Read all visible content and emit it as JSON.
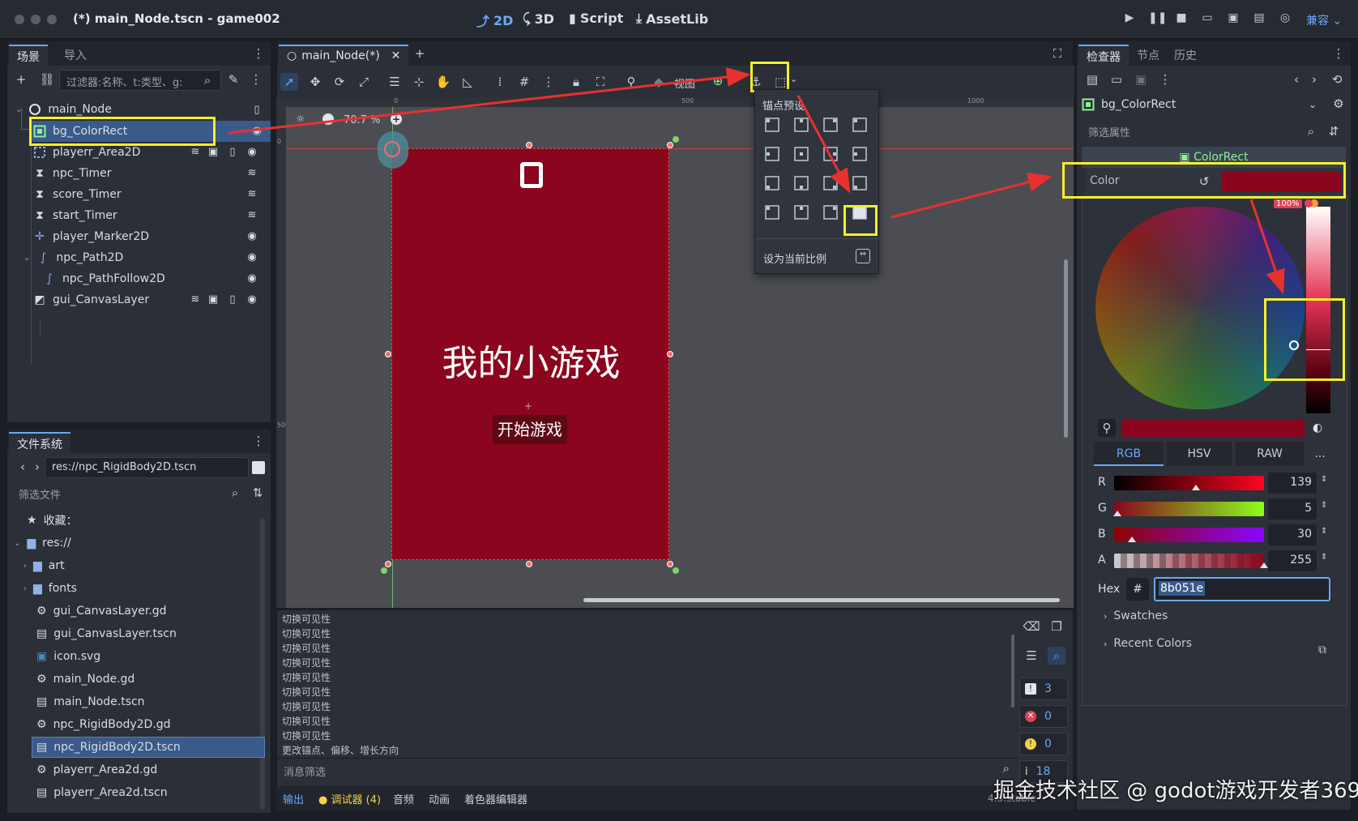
{
  "window": {
    "title": "(*) main_Node.tscn - game002"
  },
  "workspaces": [
    {
      "label": "2D",
      "icon": "2d-icon"
    },
    {
      "label": "3D",
      "icon": "3d-icon"
    },
    {
      "label": "Script",
      "icon": "script-icon"
    },
    {
      "label": "AssetLib",
      "icon": "assetlib-icon"
    }
  ],
  "renderer": "兼容",
  "scene_dock": {
    "tabs": [
      "场景",
      "导入"
    ],
    "filter_placeholder": "过滤器:名称、t:类型、g:",
    "nodes": [
      {
        "name": "main_Node",
        "icon": "node-icon"
      },
      {
        "name": "bg_ColorRect",
        "icon": "colorrect-icon"
      },
      {
        "name": "playerr_Area2D",
        "icon": "area2d-icon"
      },
      {
        "name": "npc_Timer",
        "icon": "timer-icon"
      },
      {
        "name": "score_Timer",
        "icon": "timer-icon"
      },
      {
        "name": "start_Timer",
        "icon": "timer-icon"
      },
      {
        "name": "player_Marker2D",
        "icon": "marker2d-icon"
      },
      {
        "name": "npc_Path2D",
        "icon": "path2d-icon"
      },
      {
        "name": "npc_PathFollow2D",
        "icon": "pathfollow2d-icon"
      },
      {
        "name": "gui_CanvasLayer",
        "icon": "canvaslayer-icon"
      }
    ]
  },
  "filesystem_dock": {
    "tab": "文件系统",
    "path": "res://npc_RigidBody2D.tscn",
    "filter_placeholder": "筛选文件",
    "favorites_label": "收藏：",
    "root": "res://",
    "items": [
      {
        "name": "art",
        "type": "folder"
      },
      {
        "name": "fonts",
        "type": "folder"
      },
      {
        "name": "gui_CanvasLayer.gd",
        "type": "script"
      },
      {
        "name": "gui_CanvasLayer.tscn",
        "type": "scene"
      },
      {
        "name": "icon.svg",
        "type": "image"
      },
      {
        "name": "main_Node.gd",
        "type": "script"
      },
      {
        "name": "main_Node.tscn",
        "type": "scene"
      },
      {
        "name": "npc_RigidBody2D.gd",
        "type": "script"
      },
      {
        "name": "npc_RigidBody2D.tscn",
        "type": "scene"
      },
      {
        "name": "playerr_Area2d.gd",
        "type": "script"
      },
      {
        "name": "playerr_Area2d.tscn",
        "type": "scene"
      }
    ]
  },
  "editor": {
    "scene_tab": "main_Node(*)",
    "zoom": "70.7 %",
    "view_menu": "视图",
    "ruler_marks": [
      "0",
      "500",
      "1000"
    ],
    "vruler_marks": [
      "0",
      "500"
    ]
  },
  "game_preview": {
    "title": "我的小游戏",
    "score": "0",
    "start_button": "开始游戏",
    "bg_color": "#8b051e"
  },
  "anchor_popup": {
    "title": "锚点预设",
    "keep_ratio": "设为当前比例"
  },
  "output": {
    "lines": [
      "切换可见性",
      "切换可见性",
      "切换可见性",
      "切换可见性",
      "切换可见性",
      "切换可见性",
      "切换可见性",
      "切换可见性",
      "切换可见性",
      "更改锚点、偏移、增长方向"
    ],
    "filter_placeholder": "消息筛选",
    "counts": {
      "messages": "3",
      "errors": "0",
      "warnings": "0",
      "info": "18"
    },
    "bottom_tabs": [
      "输出",
      "调试器 (4)",
      "音频",
      "动画",
      "着色器编辑器"
    ],
    "version": "4.3.stable"
  },
  "inspector": {
    "tabs": [
      "检查器",
      "节点",
      "历史"
    ],
    "node_name": "bg_ColorRect",
    "filter_placeholder": "筛选属性",
    "section": "ColorRect",
    "property": "Color",
    "color_value": "#8b051e",
    "alpha_percent": "100%",
    "modes": [
      "RGB",
      "HSV",
      "RAW",
      "..."
    ],
    "channels": [
      {
        "label": "R",
        "value": "139"
      },
      {
        "label": "G",
        "value": "5"
      },
      {
        "label": "B",
        "value": "30"
      },
      {
        "label": "A",
        "value": "255"
      }
    ],
    "hex_label": "Hex",
    "hash": "#",
    "hex_value": "8b051e",
    "swatches": "Swatches",
    "recent_colors": "Recent Colors"
  },
  "watermark": "掘金技术社区 @ godot游戏开发者369",
  "colors": {
    "accent": "#69a8ff",
    "highlight": "#f5ef2a",
    "annotation_arrow": "#e8312f"
  }
}
